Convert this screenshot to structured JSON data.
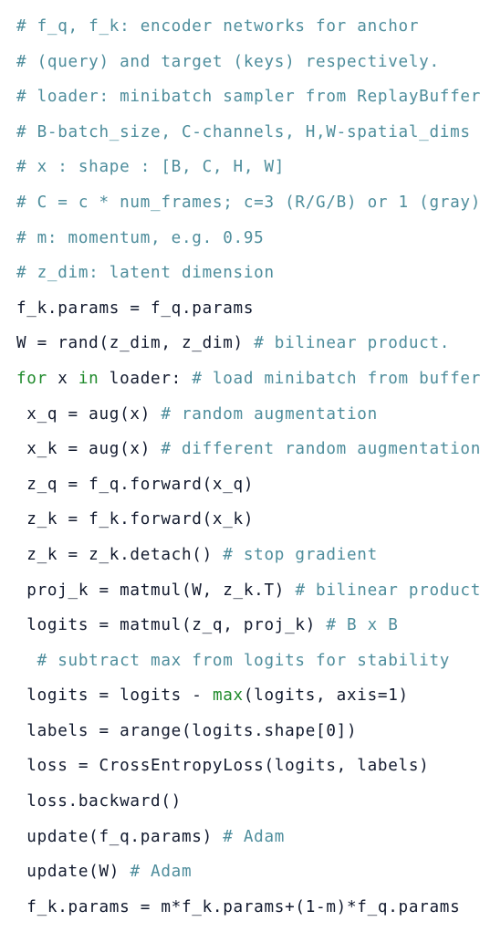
{
  "document": {
    "kind": "source-code-listing",
    "language": "python-pseudocode",
    "background_color": "#ffffff",
    "colors": {
      "code": "#121a2e",
      "comment": "#4e8d9c",
      "keyword": "#1f8a2b",
      "builtin": "#1f8a2b"
    }
  },
  "lines": [
    {
      "index": 1,
      "text": "# f_q, f_k: encoder networks for anchor",
      "tokens": [
        {
          "t": "# f_q, f_k: encoder networks for anchor",
          "c": "comment"
        }
      ]
    },
    {
      "index": 2,
      "text": "# (query) and target (keys) respectively.",
      "tokens": [
        {
          "t": "# (query) and target (keys) respectively.",
          "c": "comment"
        }
      ]
    },
    {
      "index": 3,
      "text": "# loader: minibatch sampler from ReplayBuffer",
      "tokens": [
        {
          "t": "# loader: minibatch sampler from ReplayBuffer",
          "c": "comment"
        }
      ]
    },
    {
      "index": 4,
      "text": "# B-batch_size, C-channels, H,W-spatial_dims",
      "tokens": [
        {
          "t": "# B-batch_size, C-channels, H,W-spatial_dims",
          "c": "comment"
        }
      ]
    },
    {
      "index": 5,
      "text": "# x : shape : [B, C, H, W]",
      "tokens": [
        {
          "t": "# x : shape : [B, C, H, W]",
          "c": "comment"
        }
      ]
    },
    {
      "index": 6,
      "text": "# C = c * num_frames; c=3 (R/G/B) or 1 (gray)",
      "tokens": [
        {
          "t": "# C = c * num_frames; c=3 (R/G/B) or 1 (gray)",
          "c": "comment"
        }
      ]
    },
    {
      "index": 7,
      "text": "# m: momentum, e.g. 0.95",
      "tokens": [
        {
          "t": "# m: momentum, e.g. 0.95",
          "c": "comment"
        }
      ]
    },
    {
      "index": 8,
      "text": "# z_dim: latent dimension",
      "tokens": [
        {
          "t": "# z_dim: latent dimension",
          "c": "comment"
        }
      ]
    },
    {
      "index": 9,
      "text": "f_k.params = f_q.params",
      "tokens": [
        {
          "t": "f_k.params = f_q.params",
          "c": "code"
        }
      ]
    },
    {
      "index": 10,
      "text": "W = rand(z_dim, z_dim) # bilinear product.",
      "tokens": [
        {
          "t": "W = rand(z_dim, z_dim) ",
          "c": "code"
        },
        {
          "t": "# bilinear product.",
          "c": "comment"
        }
      ]
    },
    {
      "index": 11,
      "text": "for x in loader: # load minibatch from buffer",
      "tokens": [
        {
          "t": "for",
          "c": "keyword"
        },
        {
          "t": " x ",
          "c": "code"
        },
        {
          "t": "in",
          "c": "keyword"
        },
        {
          "t": " loader: ",
          "c": "code"
        },
        {
          "t": "# load minibatch from buffer",
          "c": "comment"
        }
      ]
    },
    {
      "index": 12,
      "text": " x_q = aug(x) # random augmentation",
      "tokens": [
        {
          "t": " x_q = aug(x) ",
          "c": "code"
        },
        {
          "t": "# random augmentation",
          "c": "comment"
        }
      ]
    },
    {
      "index": 13,
      "text": " x_k = aug(x) # different random augmentation",
      "tokens": [
        {
          "t": " x_k = aug(x) ",
          "c": "code"
        },
        {
          "t": "# different random augmentation",
          "c": "comment"
        }
      ]
    },
    {
      "index": 14,
      "text": " z_q = f_q.forward(x_q)",
      "tokens": [
        {
          "t": " z_q = f_q.forward(x_q)",
          "c": "code"
        }
      ]
    },
    {
      "index": 15,
      "text": " z_k = f_k.forward(x_k)",
      "tokens": [
        {
          "t": " z_k = f_k.forward(x_k)",
          "c": "code"
        }
      ]
    },
    {
      "index": 16,
      "text": " z_k = z_k.detach() # stop gradient",
      "tokens": [
        {
          "t": " z_k = z_k.detach() ",
          "c": "code"
        },
        {
          "t": "# stop gradient",
          "c": "comment"
        }
      ]
    },
    {
      "index": 17,
      "text": " proj_k = matmul(W, z_k.T) # bilinear product",
      "tokens": [
        {
          "t": " proj_k = matmul(W, z_k.T) ",
          "c": "code"
        },
        {
          "t": "# bilinear product",
          "c": "comment"
        }
      ]
    },
    {
      "index": 18,
      "text": " logits = matmul(z_q, proj_k) # B x B",
      "tokens": [
        {
          "t": " logits = matmul(z_q, proj_k) ",
          "c": "code"
        },
        {
          "t": "# B x B",
          "c": "comment"
        }
      ]
    },
    {
      "index": 19,
      "text": "  # subtract max from logits for stability",
      "tokens": [
        {
          "t": "  ",
          "c": "code"
        },
        {
          "t": "# subtract max from logits for stability",
          "c": "comment"
        }
      ]
    },
    {
      "index": 20,
      "text": " logits = logits - max(logits, axis=1)",
      "tokens": [
        {
          "t": " logits = logits - ",
          "c": "code"
        },
        {
          "t": "max",
          "c": "builtin"
        },
        {
          "t": "(logits, axis=1)",
          "c": "code"
        }
      ]
    },
    {
      "index": 21,
      "text": " labels = arange(logits.shape[0])",
      "tokens": [
        {
          "t": " labels = arange(logits.shape[0])",
          "c": "code"
        }
      ]
    },
    {
      "index": 22,
      "text": " loss = CrossEntropyLoss(logits, labels)",
      "tokens": [
        {
          "t": " loss = CrossEntropyLoss(logits, labels)",
          "c": "code"
        }
      ]
    },
    {
      "index": 23,
      "text": " loss.backward()",
      "tokens": [
        {
          "t": " loss.backward()",
          "c": "code"
        }
      ]
    },
    {
      "index": 24,
      "text": " update(f_q.params) # Adam",
      "tokens": [
        {
          "t": " update(f_q.params) ",
          "c": "code"
        },
        {
          "t": "# Adam",
          "c": "comment"
        }
      ]
    },
    {
      "index": 25,
      "text": " update(W) # Adam",
      "tokens": [
        {
          "t": " update(W) ",
          "c": "code"
        },
        {
          "t": "# Adam",
          "c": "comment"
        }
      ]
    },
    {
      "index": 26,
      "text": " f_k.params = m*f_k.params+(1-m)*f_q.params",
      "tokens": [
        {
          "t": " f_k.params = m*f_k.params+(1-m)*f_q.params",
          "c": "code"
        }
      ]
    }
  ]
}
